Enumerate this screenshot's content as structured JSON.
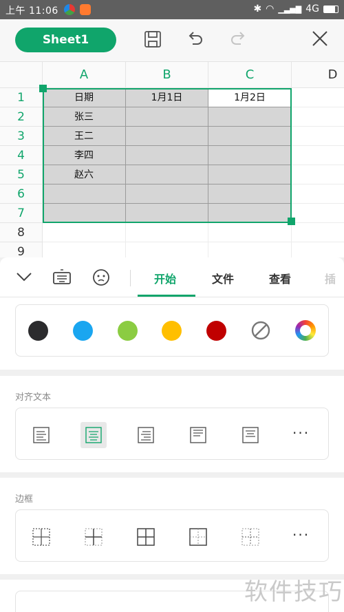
{
  "status_bar": {
    "time": "上午 11:06",
    "network": "4G"
  },
  "toolbar": {
    "sheet_label": "Sheet1"
  },
  "sheet": {
    "columns": [
      "A",
      "B",
      "C",
      "D"
    ],
    "rows": [
      "1",
      "2",
      "3",
      "4",
      "5",
      "6",
      "7",
      "8",
      "9"
    ],
    "cells": [
      [
        "日期",
        "1月1日",
        "1月2日"
      ],
      [
        "张三",
        "",
        ""
      ],
      [
        "王二",
        "",
        ""
      ],
      [
        "李四",
        "",
        ""
      ],
      [
        "赵六",
        "",
        ""
      ],
      [
        "",
        "",
        ""
      ],
      [
        "",
        "",
        ""
      ]
    ],
    "selected_fill_color": "#d6d6d6",
    "accent_color": "#10a56b"
  },
  "tabs": [
    "开始",
    "文件",
    "查看",
    "插"
  ],
  "active_tab": "开始",
  "fill_colors": {
    "label": "",
    "swatches": [
      "#2b2b2d",
      "#1aa6f0",
      "#8bcc42",
      "#ffbf00",
      "#c00000"
    ],
    "options": [
      "no-fill-icon",
      "more-colors-icon"
    ]
  },
  "align": {
    "label": "对齐文本",
    "icons": [
      "align-left-icon",
      "align-center-icon",
      "align-right-icon",
      "align-top-icon",
      "align-bottom-icon",
      "more-icon"
    ],
    "active": "align-center-icon"
  },
  "border": {
    "label": "边框",
    "icons": [
      "border-all-dashed-icon",
      "border-inner-icon",
      "border-all-icon",
      "border-outer-icon",
      "border-inner-dashed-icon",
      "more-icon"
    ]
  },
  "more_label": "···",
  "watermark": "软件技巧"
}
